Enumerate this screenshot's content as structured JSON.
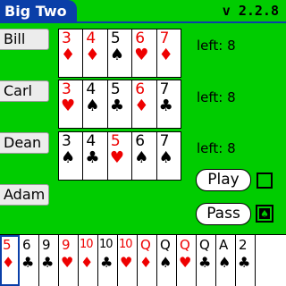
{
  "app": {
    "title": "Big Two",
    "version": "v 2.2.8"
  },
  "colors": {
    "table": "#00cc00",
    "title_bar": "#0a3fa8",
    "red_suit": "#ee0000",
    "black_suit": "#000000"
  },
  "opponents": [
    {
      "name": "Bill",
      "left_label": "left: 8",
      "cards": [
        {
          "rank": "3",
          "suit": "♦",
          "color": "red"
        },
        {
          "rank": "4",
          "suit": "♦",
          "color": "red"
        },
        {
          "rank": "5",
          "suit": "♠",
          "color": "black"
        },
        {
          "rank": "6",
          "suit": "♥",
          "color": "red"
        },
        {
          "rank": "7",
          "suit": "♦",
          "color": "red"
        }
      ]
    },
    {
      "name": "Carl",
      "left_label": "left: 8",
      "cards": [
        {
          "rank": "3",
          "suit": "♥",
          "color": "red"
        },
        {
          "rank": "4",
          "suit": "♠",
          "color": "black"
        },
        {
          "rank": "5",
          "suit": "♣",
          "color": "black"
        },
        {
          "rank": "6",
          "suit": "♦",
          "color": "red"
        },
        {
          "rank": "7",
          "suit": "♣",
          "color": "black"
        }
      ]
    },
    {
      "name": "Dean",
      "left_label": "left: 8",
      "cards": [
        {
          "rank": "3",
          "suit": "♠",
          "color": "black"
        },
        {
          "rank": "4",
          "suit": "♣",
          "color": "black"
        },
        {
          "rank": "5",
          "suit": "♥",
          "color": "red"
        },
        {
          "rank": "6",
          "suit": "♠",
          "color": "black"
        },
        {
          "rank": "7",
          "suit": "♠",
          "color": "black"
        }
      ]
    }
  ],
  "player": {
    "name": "Adam"
  },
  "buttons": {
    "play": "Play",
    "pass": "Pass"
  },
  "icons": {
    "checkbox": "empty-checkbox-icon",
    "deck": "card-deck-icon"
  },
  "hand": [
    {
      "rank": "5",
      "suit": "♦",
      "color": "red",
      "selected": true
    },
    {
      "rank": "6",
      "suit": "♣",
      "color": "black"
    },
    {
      "rank": "9",
      "suit": "♣",
      "color": "black"
    },
    {
      "rank": "9",
      "suit": "♥",
      "color": "red"
    },
    {
      "rank": "10",
      "suit": "♦",
      "color": "red"
    },
    {
      "rank": "10",
      "suit": "♣",
      "color": "black"
    },
    {
      "rank": "10",
      "suit": "♥",
      "color": "red"
    },
    {
      "rank": "Q",
      "suit": "♦",
      "color": "red"
    },
    {
      "rank": "Q",
      "suit": "♠",
      "color": "black"
    },
    {
      "rank": "Q",
      "suit": "♥",
      "color": "red"
    },
    {
      "rank": "Q",
      "suit": "♣",
      "color": "black"
    },
    {
      "rank": "A",
      "suit": "♠",
      "color": "black"
    },
    {
      "rank": "2",
      "suit": "♣",
      "color": "black"
    }
  ]
}
